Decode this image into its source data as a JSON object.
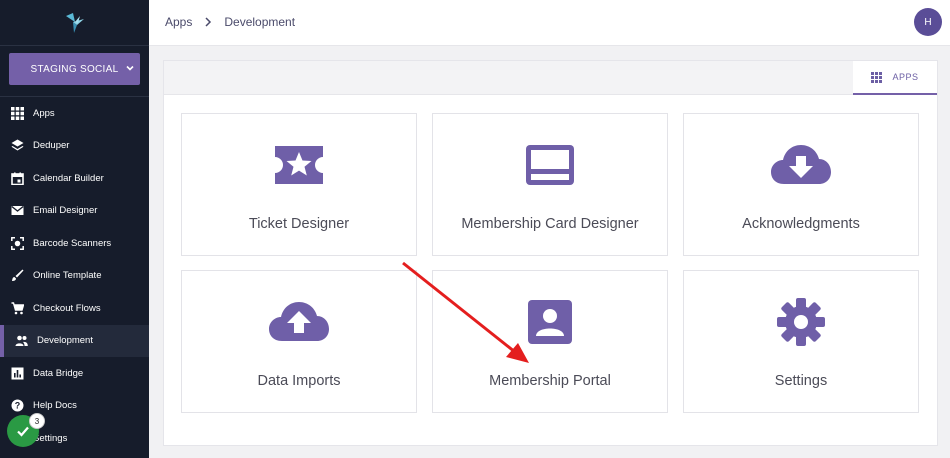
{
  "sidebar": {
    "org_name": "STAGING SOCIAL",
    "items": [
      {
        "label": "Apps",
        "icon": "grid-icon"
      },
      {
        "label": "Deduper",
        "icon": "layers-icon"
      },
      {
        "label": "Calendar Builder",
        "icon": "calendar-icon"
      },
      {
        "label": "Email Designer",
        "icon": "envelope-icon"
      },
      {
        "label": "Barcode Scanners",
        "icon": "scanner-icon"
      },
      {
        "label": "Online Template",
        "icon": "brush-icon"
      },
      {
        "label": "Checkout Flows",
        "icon": "cart-icon"
      },
      {
        "label": "Development",
        "icon": "people-icon"
      },
      {
        "label": "Data Bridge",
        "icon": "chart-icon"
      },
      {
        "label": "Help Docs",
        "icon": "help-icon"
      },
      {
        "label": "Settings",
        "icon": "gear-icon"
      }
    ],
    "active_item": "Development",
    "badge_count": "3"
  },
  "header": {
    "breadcrumb": [
      "Apps",
      "Development"
    ],
    "avatar_initial": "H"
  },
  "main": {
    "tab_label": "APPS",
    "cards": [
      {
        "label": "Ticket Designer",
        "icon": "ticket-star-icon"
      },
      {
        "label": "Membership Card Designer",
        "icon": "card-icon"
      },
      {
        "label": "Acknowledgments",
        "icon": "cloud-download-icon"
      },
      {
        "label": "Data Imports",
        "icon": "cloud-upload-icon"
      },
      {
        "label": "Membership Portal",
        "icon": "account-box-icon"
      },
      {
        "label": "Settings",
        "icon": "gear-icon"
      }
    ]
  },
  "colors": {
    "accent": "#7460a8",
    "icon_purple": "#6f5fa8",
    "sidebar_bg": "#161c2b",
    "annotation_arrow": "#e41e1e",
    "fab_green": "#2a9a44"
  }
}
